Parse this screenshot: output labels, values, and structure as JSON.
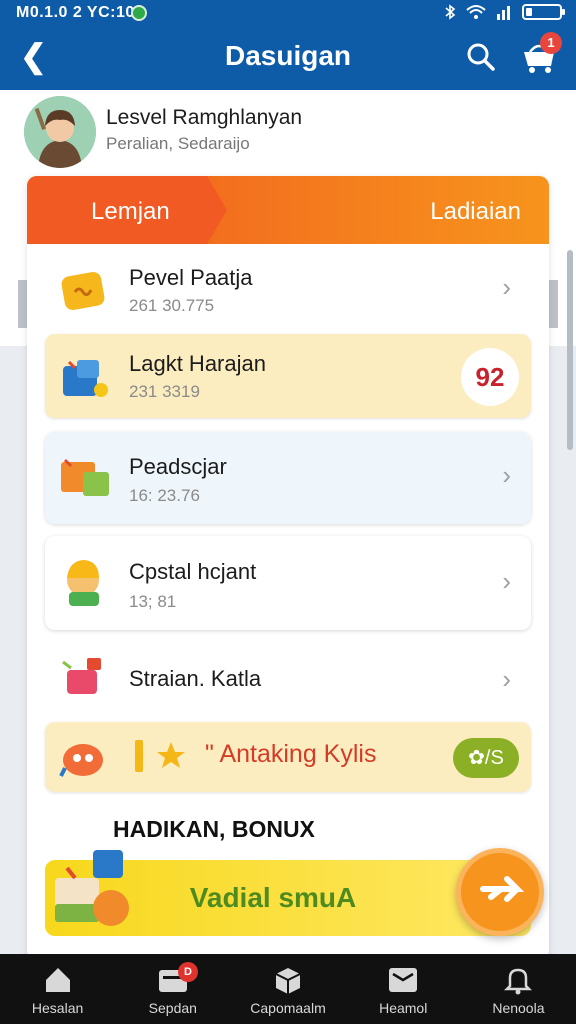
{
  "status_bar": {
    "time": "M0.1.0 2 YC:10"
  },
  "header": {
    "title": "Dasuigan",
    "cart_badge": "1"
  },
  "profile": {
    "name": "Lesvel Ramghlanyan",
    "subtitle": "Peralian, Sedaraijo"
  },
  "tabs": {
    "left": "Lemjan",
    "right": "Ladiaian"
  },
  "items": [
    {
      "label": "Pevel Paatja",
      "value": "261 30.775"
    },
    {
      "label": "Lagkt Harajan",
      "value": "231 3319",
      "badge": "92"
    },
    {
      "label": "Peadscjar",
      "value": "16: 23.76"
    },
    {
      "label": "Cpstal hcjant",
      "value": "13; 81"
    },
    {
      "label": "Straian. Katla"
    }
  ],
  "promo": {
    "text": "\" Antaking Kylis",
    "pill": "✿/S"
  },
  "bonus": {
    "heading": "HADIKAN, BONUX",
    "button": "Vadial smuA"
  },
  "bottom_nav": [
    {
      "label": "Hesalan",
      "icon": "home-icon"
    },
    {
      "label": "Sepdan",
      "icon": "wallet-icon",
      "badge": "D"
    },
    {
      "label": "Capomaalm",
      "icon": "box-icon"
    },
    {
      "label": "Heamol",
      "icon": "message-icon"
    },
    {
      "label": "Nenoola",
      "icon": "bell-icon"
    }
  ],
  "colors": {
    "header": "#0e5ca8",
    "accent": "#f7941d",
    "banner": "#f15a22",
    "badge": "#e8453c",
    "promo_text": "#d43c27",
    "bonus_text": "#4d8a1f"
  }
}
